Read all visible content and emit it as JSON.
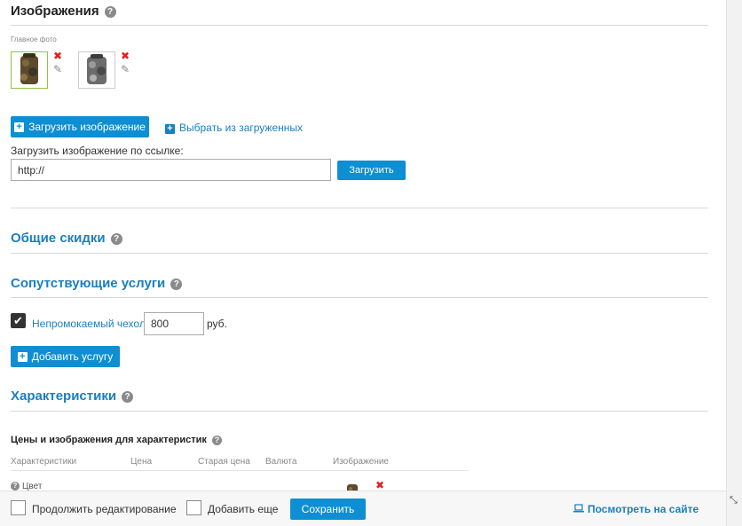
{
  "images_section": {
    "title": "Изображения",
    "main_photo_label": "Главное фото",
    "upload_button": "Загрузить изображение",
    "choose_link": "Выбрать из загруженных",
    "url_label": "Загрузить изображение по ссылке:",
    "url_value": "http://",
    "url_upload_button": "Загрузить"
  },
  "discounts_section": {
    "title": "Общие скидки"
  },
  "services_section": {
    "title": "Сопутствующие услуги",
    "service_name": "Непромокаемый чехол",
    "service_price": "800",
    "currency": "руб.",
    "add_service_button": "Добавить услугу"
  },
  "characteristics_section": {
    "title": "Характеристики",
    "subtitle": "Цены и изображения для характеристик",
    "columns": [
      "Характеристики",
      "Цена",
      "Старая цена",
      "Валюта",
      "Изображение"
    ],
    "row_label": "Цвет"
  },
  "footer": {
    "continue_label": "Продолжить редактирование",
    "add_more_label": "Добавить еще",
    "save_button": "Сохранить",
    "view_on_site": "Посмотреть на сайте"
  },
  "colors": {
    "accent": "#0e8ed3",
    "link": "#1a7fc1",
    "delete": "#e02020",
    "main_border": "#8dc63f"
  }
}
